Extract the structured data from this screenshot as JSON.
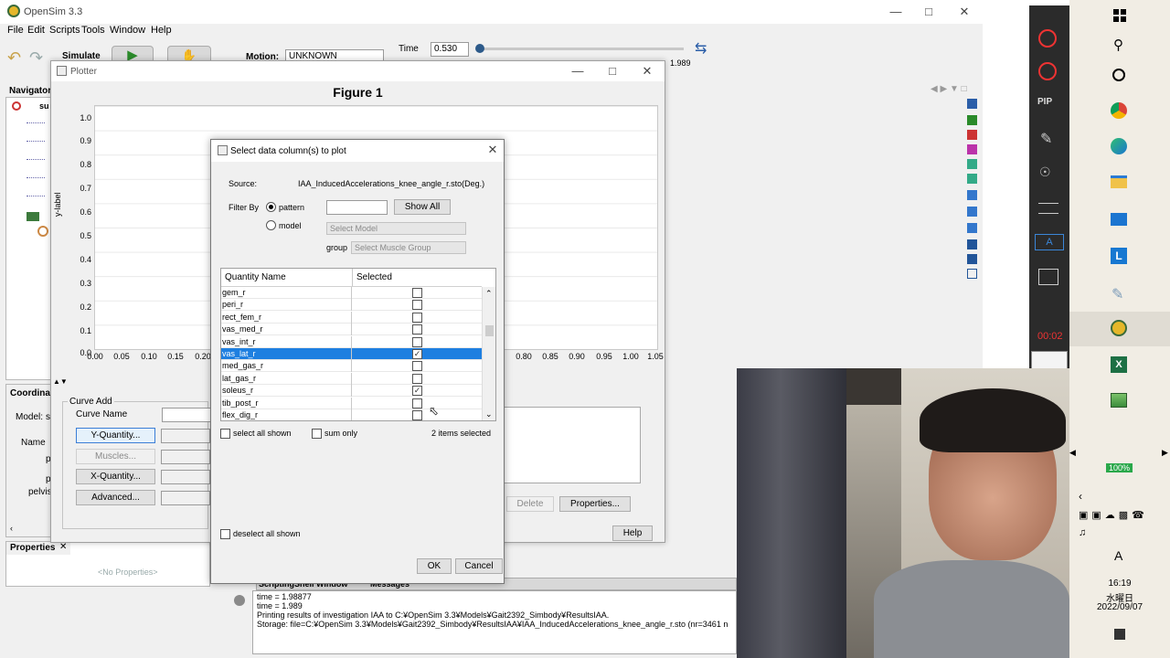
{
  "app": {
    "title": "OpenSim 3.3",
    "menu": [
      "File",
      "Edit",
      "Scripts",
      "Tools",
      "Window",
      "Help"
    ],
    "simulate_label": "Simulate",
    "motion_label": "Motion:",
    "motion_value": "UNKNOWN",
    "time_label": "Time",
    "time_value": "0.530",
    "time_end": "1.989",
    "navigator_label": "Navigator",
    "nav_model_short": "su",
    "coordinates_label": "Coordinat",
    "model_label": "Model:",
    "model_value": "s",
    "name_label": "Name",
    "pelvis_label": "pelvis",
    "p_label": "p",
    "properties_label": "Properties",
    "no_properties": "<No Properties>",
    "tab_scripting": "ScriptingShell Window",
    "tab_messages": "Messages",
    "console_lines": [
      "time = 1.98877",
      "time = 1.989",
      "Printing results of investigation IAA to C:¥OpenSim 3.3¥Models¥Gait2392_Simbody¥ResultsIAA.",
      "Storage: file=C:¥OpenSim 3.3¥Models¥Gait2392_Simbody¥ResultsIAA¥IAA_InducedAccelerations_knee_angle_r.sto (nr=3461 n"
    ]
  },
  "plotter": {
    "title": "Plotter",
    "figure_title": "Figure 1",
    "ylabel": "y-label",
    "yticks": [
      "1.0",
      "0.9",
      "0.8",
      "0.7",
      "0.6",
      "0.5",
      "0.4",
      "0.3",
      "0.2",
      "0.1",
      "0.0"
    ],
    "xticks_left": [
      "0.00",
      "0.05",
      "0.10",
      "0.15",
      "0.20"
    ],
    "xticks_right": [
      "0.80",
      "0.85",
      "0.90",
      "0.95",
      "1.00",
      "1.05"
    ],
    "curve_add_label": "Curve Add",
    "curve_name_label": "Curve Name",
    "buttons": {
      "y_quantity": "Y-Quantity...",
      "muscles": "Muscles...",
      "x_quantity": "X-Quantity...",
      "advanced": "Advanced...",
      "delete": "Delete",
      "properties": "Properties...",
      "help": "Help"
    }
  },
  "dialog": {
    "title": "Select data column(s) to plot",
    "source_label": "Source:",
    "source_value": "IAA_InducedAccelerations_knee_angle_r.sto(Deg.)",
    "filter_by_label": "Filter By",
    "pattern_label": "pattern",
    "model_label": "model",
    "show_all": "Show All",
    "select_model": "Select Model",
    "group_label": "group",
    "select_muscle_group": "Select Muscle Group",
    "col_quantity": "Quantity Name",
    "col_selected": "Selected",
    "rows": [
      {
        "name": "gem_r",
        "checked": false,
        "selected": false
      },
      {
        "name": "peri_r",
        "checked": false,
        "selected": false
      },
      {
        "name": "rect_fem_r",
        "checked": false,
        "selected": false
      },
      {
        "name": "vas_med_r",
        "checked": false,
        "selected": false
      },
      {
        "name": "vas_int_r",
        "checked": false,
        "selected": false
      },
      {
        "name": "vas_lat_r",
        "checked": true,
        "selected": true
      },
      {
        "name": "med_gas_r",
        "checked": false,
        "selected": false
      },
      {
        "name": "lat_gas_r",
        "checked": false,
        "selected": false
      },
      {
        "name": "soleus_r",
        "checked": true,
        "selected": false
      },
      {
        "name": "tib_post_r",
        "checked": false,
        "selected": false
      },
      {
        "name": "flex_dig_r",
        "checked": false,
        "selected": false
      }
    ],
    "select_all_shown": "select all shown",
    "sum_only": "sum only",
    "items_selected": "2 items selected",
    "deselect_all_shown": "deselect all shown",
    "ok": "OK",
    "cancel": "Cancel"
  },
  "system": {
    "recorder_time": "00:02",
    "zoom": "100%",
    "ime": "A",
    "clock_time": "16:19",
    "clock_day": "水曜日",
    "clock_date": "2022/09/07"
  }
}
